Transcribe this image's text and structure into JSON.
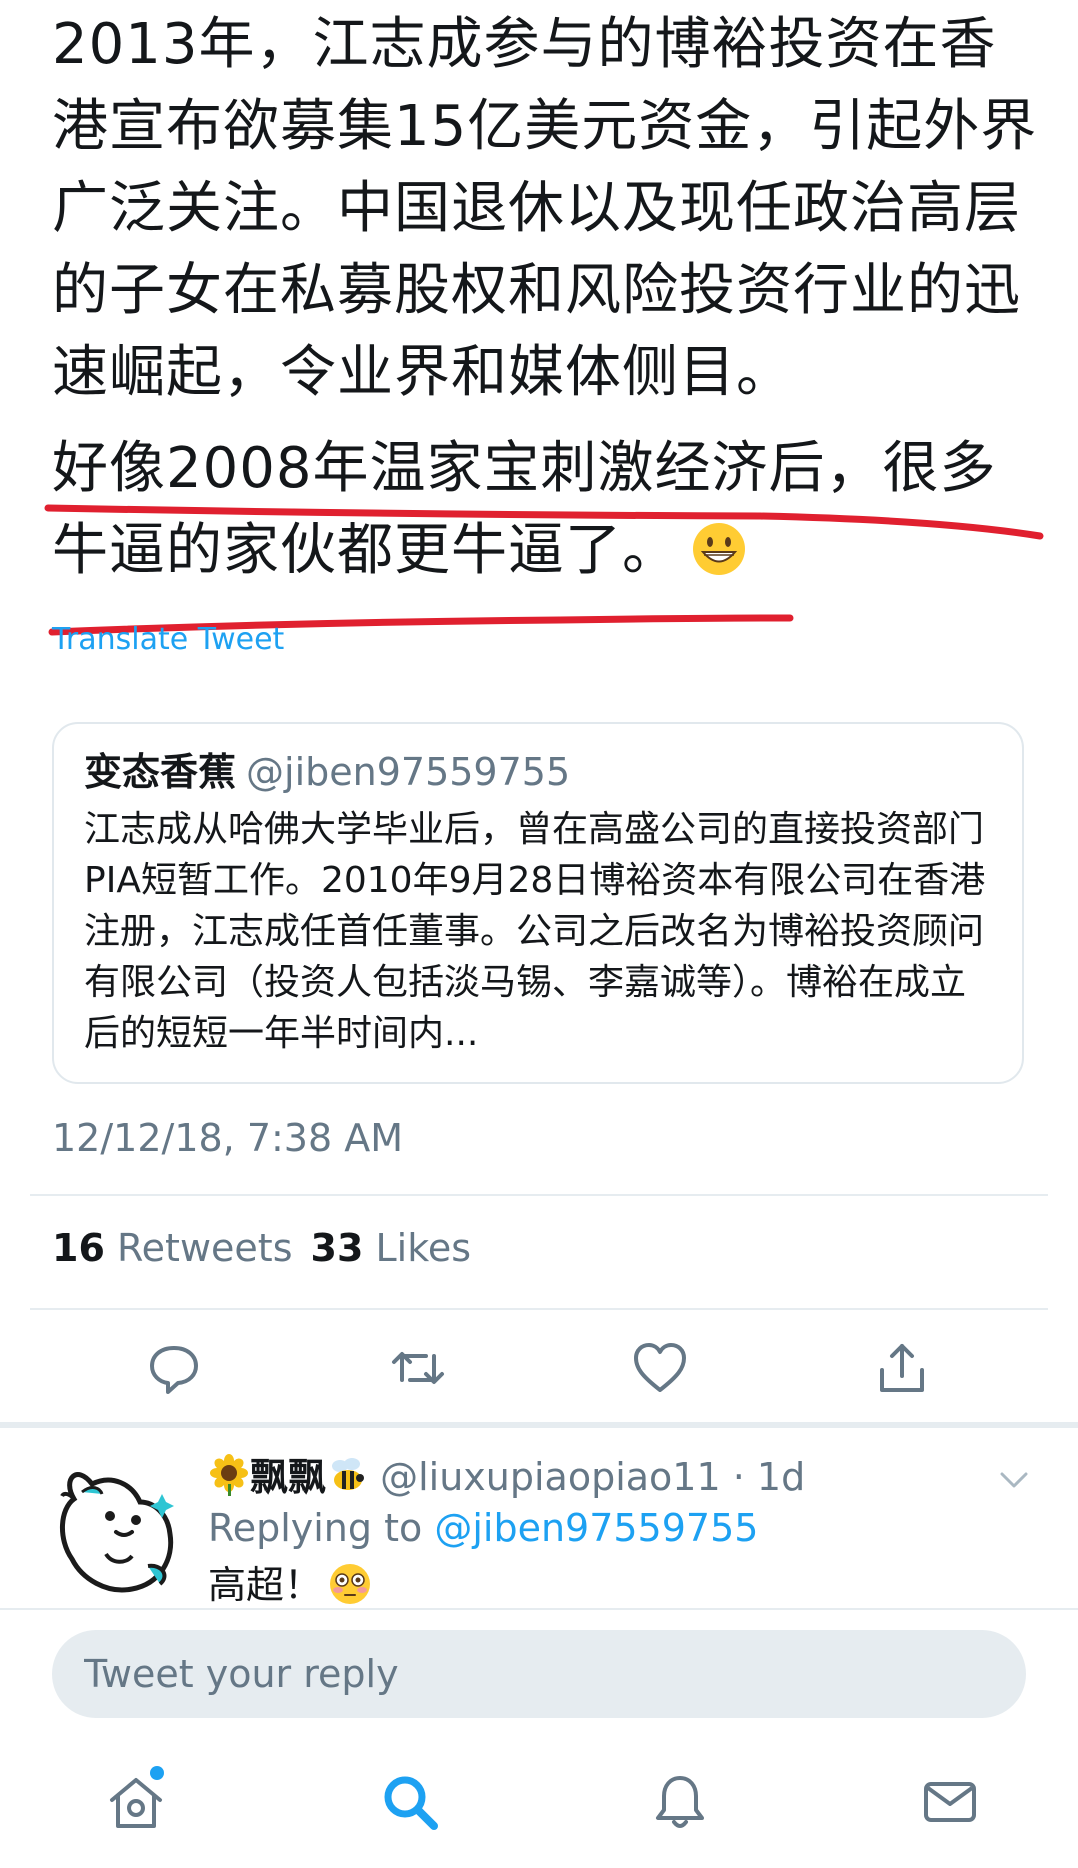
{
  "tweet": {
    "paragraph1": "2013年，江志成参与的博裕投资在香港宣布欲募集15亿美元资金，引起外界广泛关注。中国退休以及现任政治高层的子女在私募股权和风险投资行业的迅速崛起，令业界和媒体侧目。",
    "paragraph2": "好像2008年温家宝刺激经济后，很多牛逼的家伙都更牛逼了。",
    "translate_label": "Translate Tweet",
    "timestamp": "12/12/18, 7:38 AM"
  },
  "quoted_tweet": {
    "name": "变态香蕉",
    "handle": "@jiben97559755",
    "text": "江志成从哈佛大学毕业后，曾在高盛公司的直接投资部门PIA短暂工作。2010年9月28日博裕资本有限公司在香港注册，江志成任首任董事。公司之后改名为博裕投资顾问有限公司（投资人包括淡马锡、李嘉诚等）。博裕在成立后的短短一年半时间内..."
  },
  "stats": {
    "retweets_count": "16",
    "retweets_label": "Retweets",
    "likes_count": "33",
    "likes_label": "Likes"
  },
  "actions": [
    "reply-icon",
    "retweet-icon",
    "like-icon",
    "share-icon"
  ],
  "reply": {
    "name": "飘飘",
    "handle": "@liuxupiaopiao11",
    "time": "1d",
    "replying_prefix": "Replying to",
    "replying_to": "@jiben97559755",
    "text": "高超！"
  },
  "compose": {
    "placeholder": "Tweet your reply"
  },
  "tabbar": [
    "home-icon",
    "search-icon",
    "notifications-icon",
    "messages-icon"
  ],
  "colors": {
    "accent": "#1da1f2",
    "annotation": "#e0202f",
    "muted": "#657786"
  }
}
